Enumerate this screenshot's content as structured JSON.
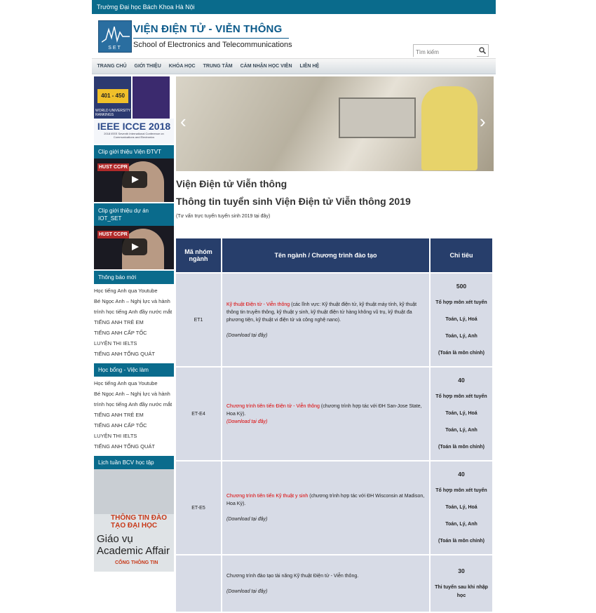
{
  "topbar": {
    "text": "Trường Đại học Bách Khoa Hà Nội"
  },
  "header": {
    "logo_text": "SET",
    "title": "VIỆN ĐIỆN TỬ - VIỄN THÔNG",
    "subtitle": "School of Electronics and Telecommunications",
    "search_placeholder": "Tìm kiếm"
  },
  "nav": {
    "items": [
      "TRANG CHỦ",
      "GIỚI THIỆU",
      "KHÓA HỌC",
      "TRUNG TÂM",
      "CẢM NHẬN HỌC VIÊN",
      "LIÊN HỆ"
    ]
  },
  "sidebar": {
    "rank_badge": "401 - 450",
    "rank_caption": "WORLD UNIVERSITY RANKINGS",
    "icce_title": "IEEE ICCE 2018",
    "icce_sub": "2018 IEEE Seventh International Conference on Communications and Electronics",
    "video1_heading": "Clip giới thiệu Viện ĐTVT",
    "video2_heading": "Clip giới thiệu dự án IOT_SET",
    "video_label": "HUST CCPR",
    "notice_heading": "Thông báo mới",
    "notice_items": [
      "Học tiếng Anh qua Youtube",
      "Bé Ngọc Anh – Nghị lực và hành",
      "trình học tiếng Anh đầy nước mắt",
      "TIẾNG ANH TRẺ EM",
      "TIẾNG ANH CẤP TỐC",
      "LUYỆN THI IELTS",
      "TIẾNG ANH TỔNG QUÁT"
    ],
    "scholar_heading": "Học bổng - Việc làm",
    "scholar_items": [
      "Học tiếng Anh qua Youtube",
      "Bé Ngọc Anh – Nghị lực và hành",
      "trình học tiếng Anh đầy nước mắt",
      "TIẾNG ANH TRẺ EM",
      "TIẾNG ANH CẤP TỐC",
      "LUYỆN THI IELTS",
      "TIẾNG ANH TỔNG QUÁT"
    ],
    "schedule_heading": "Lịch tuần BCV học tập",
    "schedule_title": "THÔNG TIN ĐÀO TẠO ĐẠI HỌC",
    "schedule_sub": "Giáo vụ Academic Affair",
    "portal": "CỔNG THÔNG TIN"
  },
  "main": {
    "heading": "Viện Điện tử Viễn thông",
    "subheading": "Thông tin tuyển sinh Viện Điện tử Viễn thông 2019",
    "note": "(Tư vấn trực tuyến tuyển sinh 2019 tại đây)",
    "table": {
      "headers": [
        "Mã nhóm ngành",
        "Tên ngành / Chương trình đào tạo",
        "Chỉ tiêu"
      ],
      "rows": [
        {
          "code": "ET1",
          "name": "Kỹ thuật Điện tử - Viễn thông",
          "detail": " (các lĩnh vực: Kỹ thuật điện tử, kỹ thuật máy tính, kỹ thuật thông tin truyền thông, kỹ thuật y sinh, kỹ thuật điện tử hàng không vũ trụ, kỹ thuật đa phương tiện, kỹ thuật vi điện tử và công nghệ nano).",
          "download": "(Download tại đây)",
          "quota": "500",
          "combo_label": "Tổ hợp môn xét tuyển",
          "combo1": "Toán, Lý, Hoá",
          "combo2": "Toán, Lý, Anh",
          "combo_note": "(Toán là môn chính)"
        },
        {
          "code": "ET-E4",
          "name": "Chương trình tiên tiến Điện tử - Viễn thông",
          "detail": " (chương trình hợp tác với ĐH San-Jose State, Hoa Kỳ).",
          "download": "(Download tại đây)",
          "quota": "40",
          "combo_label": "Tổ hợp môn xét tuyển",
          "combo1": "Toán, Lý, Hoá",
          "combo2": "Toán, Lý, Anh",
          "combo_note": "(Toán là môn chính)"
        },
        {
          "code": "ET-E5",
          "name": "Chương trình tiên tiến Kỹ thuật y sinh",
          "detail": " (chương trình hợp tác với ĐH Wisconsin at Madison, Hoa Kỳ).",
          "download": "(Download tại đây)",
          "quota": "40",
          "combo_label": "Tổ hợp môn xét tuyển",
          "combo1": "Toán, Lý, Hoá",
          "combo2": "Toán, Lý, Anh",
          "combo_note": "(Toán là môn chính)"
        },
        {
          "code": "",
          "name": "",
          "detail": "Chương trình đào tạo tài năng Kỹ thuật Điện tử - Viễn thông.",
          "download": "(Download tại đây)",
          "quota": "30",
          "combo_label": "Thi tuyển sau khi nhập học",
          "combo1": "",
          "combo2": "",
          "combo_note": ""
        }
      ]
    }
  },
  "colors": {
    "primary": "#0a6b8c",
    "table_header": "#273e6b",
    "table_cell": "#d7dbe6",
    "link_red": "#dd0000"
  }
}
